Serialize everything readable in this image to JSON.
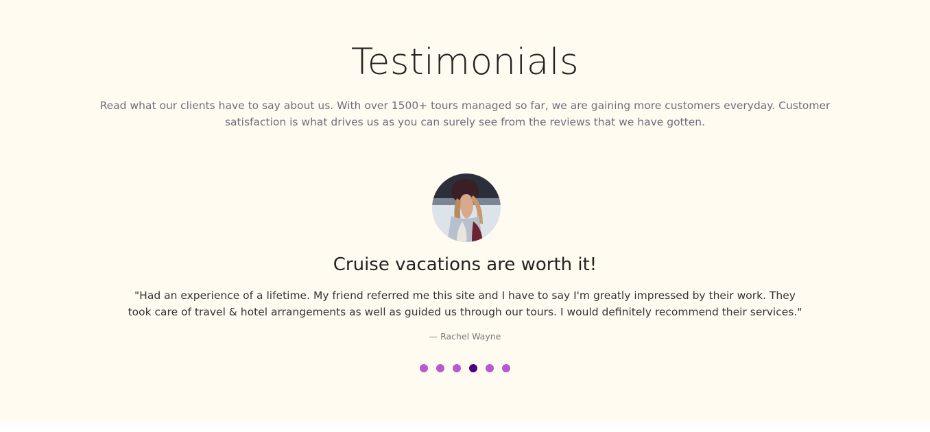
{
  "testimonials": {
    "heading": "Testimonials",
    "intro": "Read what our clients have to say about us. With over 1500+ tours managed so far, we are gaining more customers everyday. Customer satisfaction is what drives us as you can surely see from the reviews that we have gotten.",
    "current": {
      "title": "Cruise vacations are worth it!",
      "quote": "\"Had an experience of a lifetime. My friend referred me this site and I have to say I'm greatly impressed by their work. They took care of travel & hotel arrangements as well as guided us through our tours. I would definitely recommend their services.\"",
      "author": "— Rachel Wayne"
    },
    "slide_count": 6,
    "active_slide": 4
  },
  "colors": {
    "background": "#fffbf0",
    "dot": "#b75ad1",
    "dot_active": "#4b0082",
    "heading": "#222222",
    "muted": "#6c6f7b"
  }
}
